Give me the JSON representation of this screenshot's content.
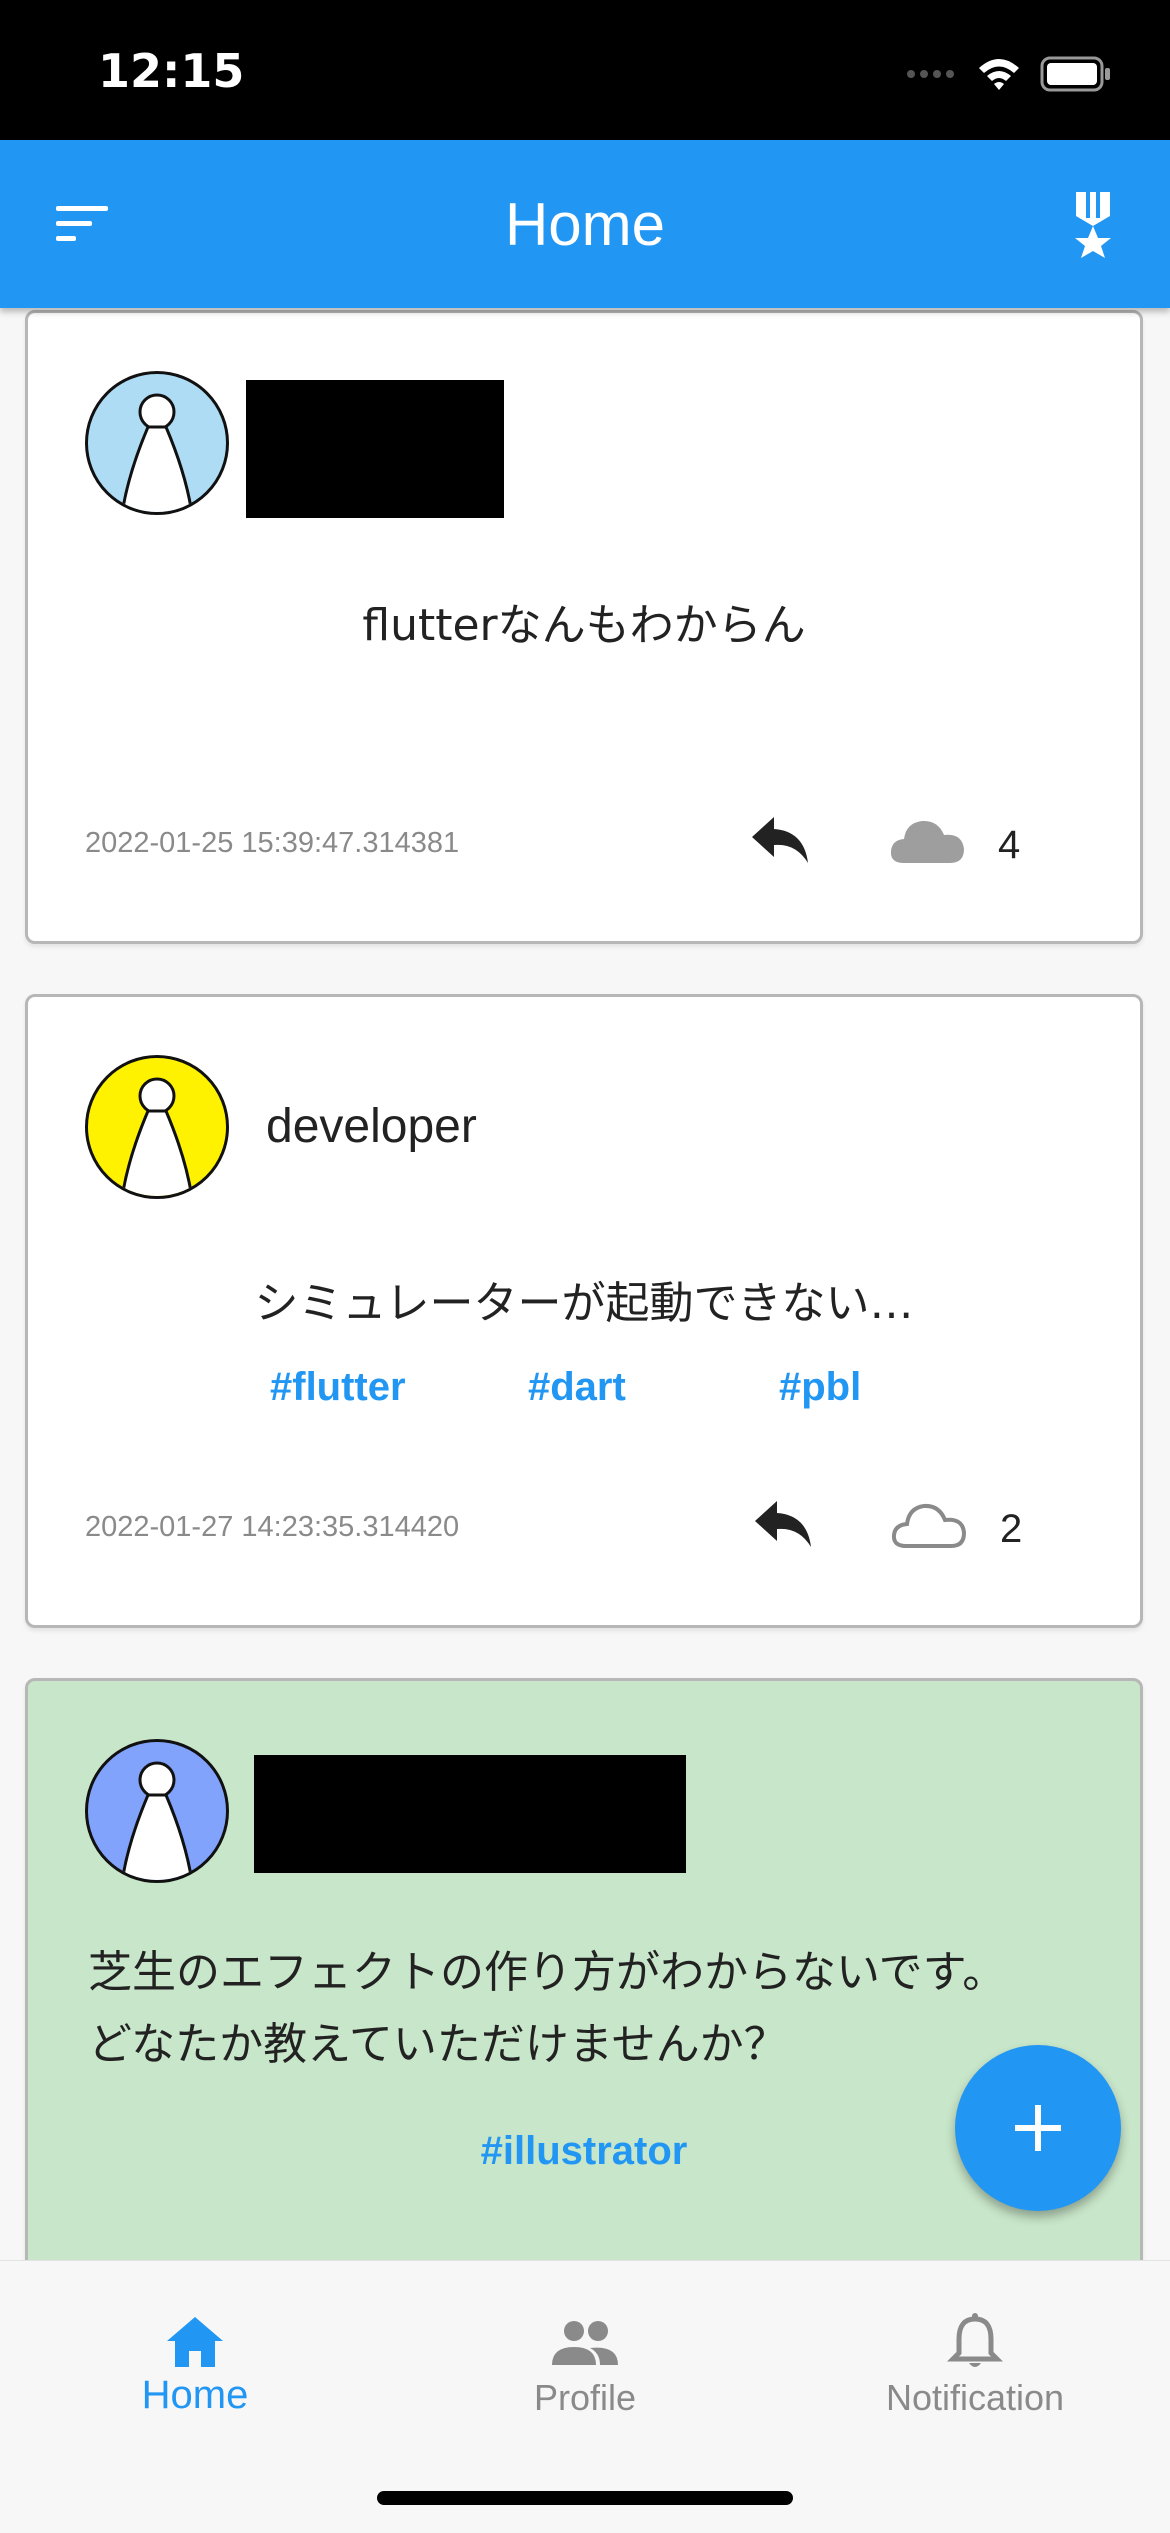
{
  "status_bar": {
    "time": "12:15"
  },
  "app_bar": {
    "title": "Home",
    "menu_icon": "sort-icon",
    "right_icon": "medal-icon"
  },
  "posts": [
    {
      "avatar_color": "#aedcf4",
      "username": "",
      "text": "flutterなんもわからん",
      "tags": [],
      "timestamp": "2022-01-25 15:39:47.314381",
      "count": "4",
      "cloud_filled": true,
      "background": "#ffffff"
    },
    {
      "avatar_color": "#fff200",
      "username": "developer",
      "text": "シミュレーターが起動できない…",
      "tags": [
        "#flutter",
        "#dart",
        "#pbl"
      ],
      "timestamp": "2022-01-27 14:23:35.314420",
      "count": "2",
      "cloud_filled": false,
      "background": "#ffffff"
    },
    {
      "avatar_color": "#82a3fb",
      "username": "",
      "text_lines": [
        "芝生のエフェクトの作り方がわからないです。",
        "どなたか教えていただけませんか？"
      ],
      "tags": [
        "#illustrator"
      ],
      "background": "#c8e6c9"
    }
  ],
  "fab": {
    "icon": "plus-icon"
  },
  "bottom_nav": {
    "items": [
      {
        "label": "Home",
        "icon": "home-icon",
        "active": true
      },
      {
        "label": "Profile",
        "icon": "people-icon",
        "active": false
      },
      {
        "label": "Notification",
        "icon": "bell-icon",
        "active": false
      }
    ]
  },
  "colors": {
    "primary": "#2196f3",
    "inactive": "#8a8a8a"
  }
}
